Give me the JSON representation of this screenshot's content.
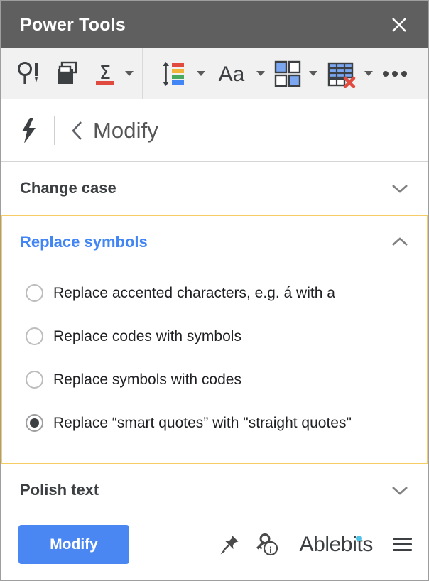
{
  "window": {
    "title": "Power Tools",
    "close_label": "close-icon"
  },
  "toolbar": {
    "groups": [
      {
        "items": [
          {
            "icon": "find-and-replace-icon",
            "label": "Find and replace"
          },
          {
            "icon": "sheets-manager-icon",
            "label": "Sheets"
          },
          {
            "icon": "sum-formulas-icon",
            "label": "Formulas"
          }
        ],
        "has_caret": true
      },
      {
        "items": [
          {
            "icon": "sort-color-icon",
            "label": "Sort and filter"
          },
          {
            "icon": "text-icon",
            "label": "Text"
          },
          {
            "icon": "split-merge-icon",
            "label": "Split and merge"
          },
          {
            "icon": "clear-table-icon",
            "label": "Clear and remove"
          },
          {
            "icon": "more-dots-icon",
            "label": "More tools"
          }
        ]
      }
    ]
  },
  "header": {
    "app_icon": "lightning-bolt-icon",
    "back_icon": "chevron-left-icon",
    "title": "Modify"
  },
  "sections": [
    {
      "id": "change-case",
      "title": "Change case",
      "expanded": false,
      "chevron": "chevron-down-icon"
    },
    {
      "id": "replace-symbols",
      "title": "Replace symbols",
      "expanded": true,
      "chevron": "chevron-up-icon",
      "options": [
        {
          "label": "Replace accented characters, e.g. á with a",
          "selected": false
        },
        {
          "label": "Replace codes with symbols",
          "selected": false
        },
        {
          "label": "Replace symbols with codes",
          "selected": false
        },
        {
          "label": "Replace “smart quotes” with \"straight quotes\"",
          "selected": true
        }
      ]
    },
    {
      "id": "polish-text",
      "title": "Polish text",
      "expanded": false,
      "chevron": "chevron-down-icon"
    }
  ],
  "footer": {
    "primary_button": "Modify",
    "pin_icon": "pin-icon",
    "help_icon": "key-info-icon",
    "brand": "Ablebits",
    "menu_icon": "hamburger-menu-icon"
  },
  "colors": {
    "titlebar_bg": "#5f5f5f",
    "toolbar_bg": "#f1f1f1",
    "accent_blue": "#4285f4",
    "button_blue": "#4a87f2",
    "expanded_border": "#f5cc63",
    "brand_dot": "#4fc3e8"
  }
}
